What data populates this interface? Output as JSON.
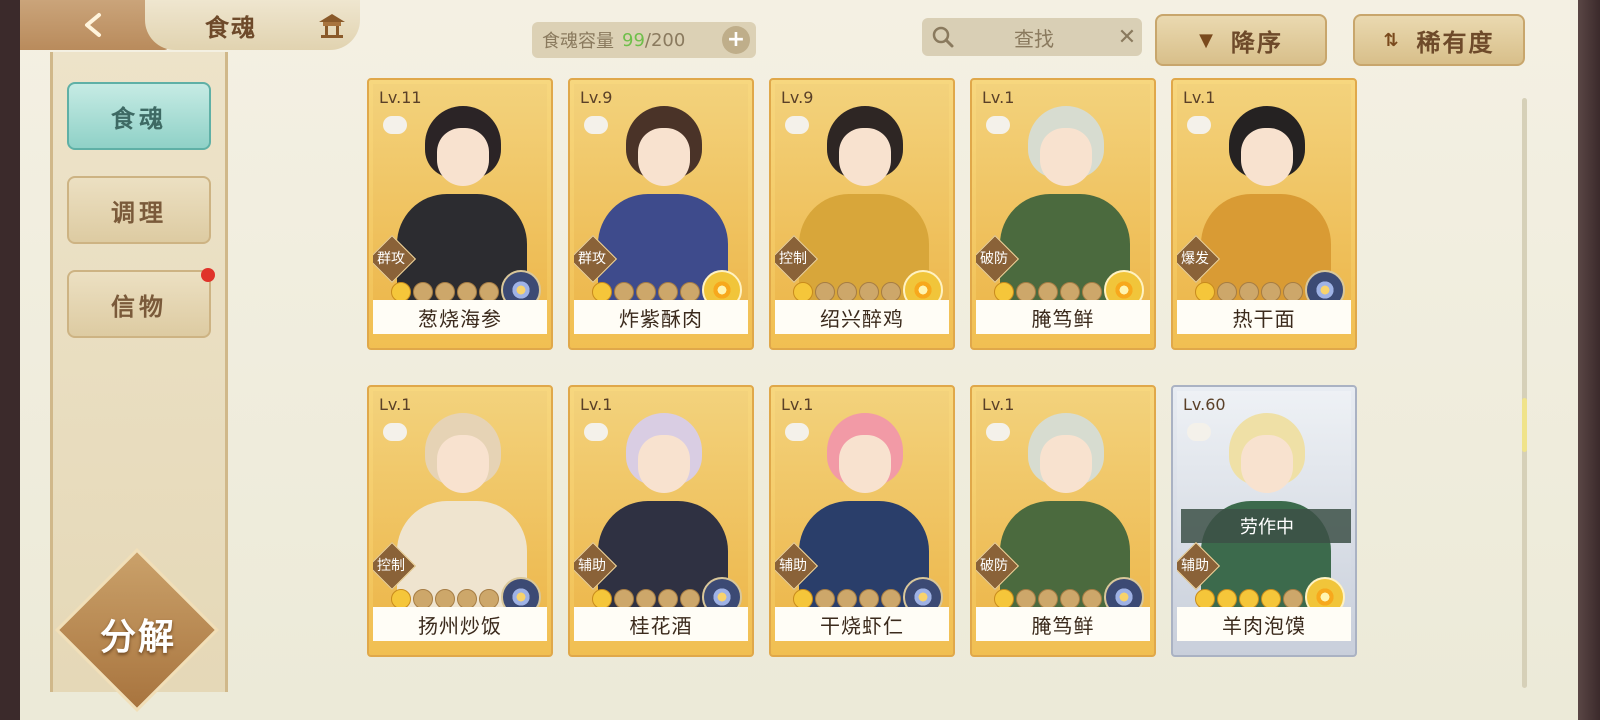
{
  "header": {
    "title": "食魂",
    "capacity_label": "食魂容量",
    "capacity_current": "99",
    "capacity_max": "/200",
    "search_label": "查找",
    "sort_order_label": "降序",
    "sort_key_label": "稀有度"
  },
  "sidebar": {
    "items": [
      {
        "label": "食魂",
        "active": true
      },
      {
        "label": "调理",
        "active": false
      },
      {
        "label": "信物",
        "active": false,
        "has_notification": true
      }
    ],
    "decompose_label": "分解"
  },
  "cards": [
    {
      "level": "Lv.11",
      "role": "群攻",
      "name": "葱烧海参",
      "filled_stars": 1,
      "element": "blue-flower-icon",
      "hair": "#2b2426",
      "body": "#2c2c30"
    },
    {
      "level": "Lv.9",
      "role": "群攻",
      "name": "炸紫酥肉",
      "filled_stars": 1,
      "element": "gold-flower-icon",
      "hair": "#4a3328",
      "body": "#3e4b8c"
    },
    {
      "level": "Lv.9",
      "role": "控制",
      "name": "绍兴醉鸡",
      "filled_stars": 1,
      "element": "gold-flower-icon",
      "hair": "#2e2624",
      "body": "#d8a63a"
    },
    {
      "level": "Lv.1",
      "role": "破防",
      "name": "腌笃鲜",
      "filled_stars": 1,
      "element": "gold-flower-icon",
      "hair": "#d7dcd0",
      "body": "#4b6a3e"
    },
    {
      "level": "Lv.1",
      "role": "爆发",
      "name": "热干面",
      "filled_stars": 1,
      "element": "blue-flower-icon",
      "hair": "#252222",
      "body": "#d99b34"
    },
    {
      "level": "Lv.1",
      "role": "控制",
      "name": "扬州炒饭",
      "filled_stars": 1,
      "element": "blue-flower-icon",
      "hair": "#e6d3b5",
      "body": "#efe4cf"
    },
    {
      "level": "Lv.1",
      "role": "辅助",
      "name": "桂花酒",
      "filled_stars": 1,
      "element": "blue-flower-icon",
      "hair": "#d9cde3",
      "body": "#2f3142"
    },
    {
      "level": "Lv.1",
      "role": "辅助",
      "name": "干烧虾仁",
      "filled_stars": 1,
      "element": "blue-flower-icon",
      "hair": "#f29aa6",
      "body": "#2a3e6a"
    },
    {
      "level": "Lv.1",
      "role": "破防",
      "name": "腌笃鲜",
      "filled_stars": 1,
      "element": "blue-flower-icon",
      "hair": "#d7dcd0",
      "body": "#4b6a3e"
    },
    {
      "level": "Lv.60",
      "role": "辅助",
      "name": "羊肉泡馍",
      "filled_stars": 4,
      "element": "gold-flower-icon",
      "hair": "#efe0a6",
      "body": "#3c6a4c",
      "status": "劳作中",
      "silver": true
    }
  ]
}
